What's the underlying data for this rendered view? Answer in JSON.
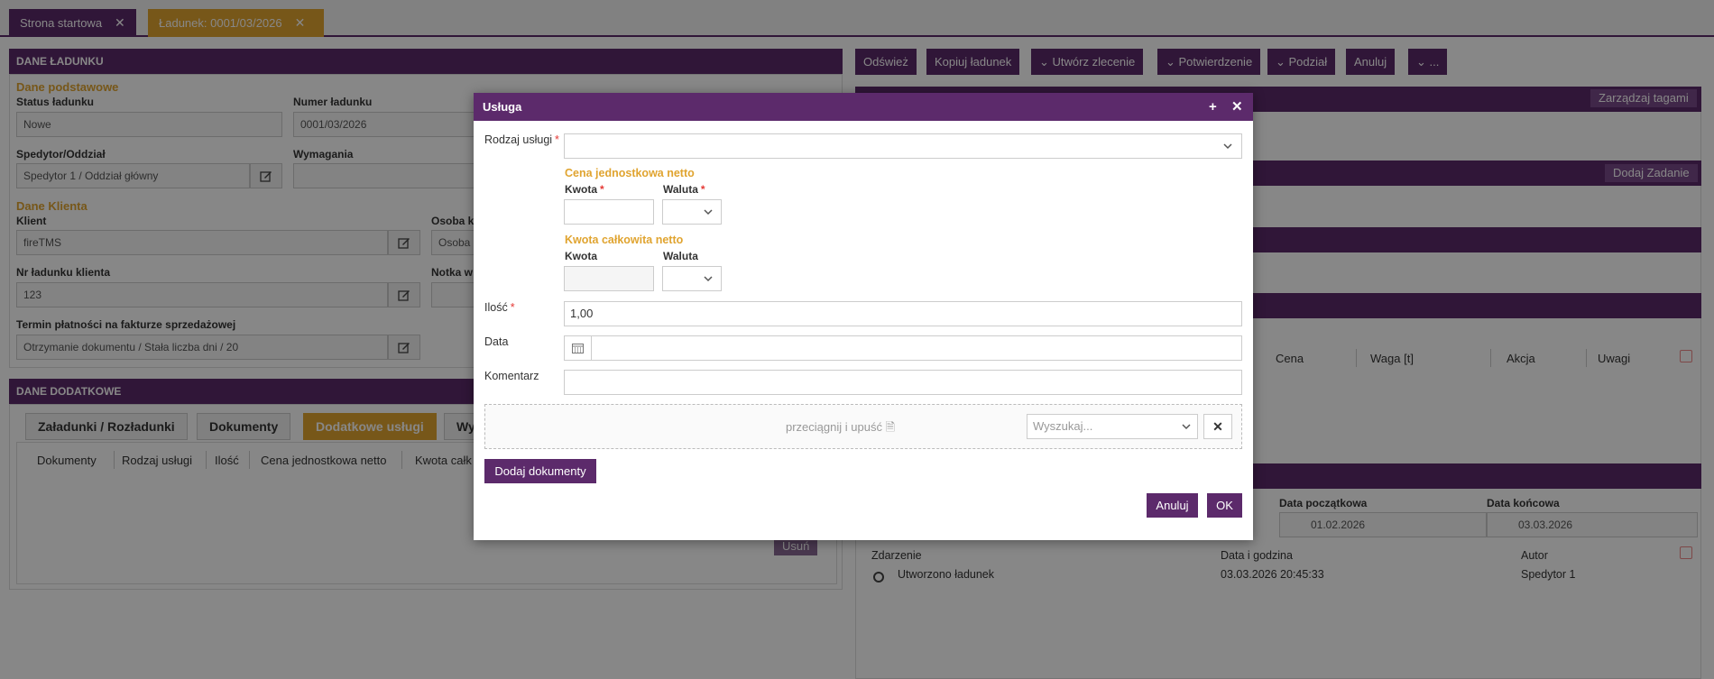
{
  "tabs": [
    {
      "label": "Strona startowa"
    },
    {
      "label": "Ładunek: 0001/03/2026"
    }
  ],
  "cargo_panel": {
    "title": "DANE ŁADUNKU",
    "basic_section": "Dane podstawowe",
    "status_label": "Status ładunku",
    "status_value": "Nowe",
    "number_label": "Numer ładunku",
    "number_value": "0001/03/2026",
    "forwarder_label": "Spedytor/Oddział",
    "forwarder_value": "Spedytor 1 / Oddział główny",
    "requirements_label": "Wymagania",
    "client_section": "Dane Klienta",
    "client_label": "Klient",
    "client_value": "fireTMS",
    "contact_label": "Osoba k",
    "contact_value": "Osoba",
    "client_no_label": "Nr ładunku klienta",
    "client_no_value": "123",
    "note_label": "Notka w",
    "payment_label": "Termin płatności na fakturze sprzedażowej",
    "payment_value": "Otrzymanie dokumentu / Stała liczba dni / 20"
  },
  "extra_panel": {
    "title": "DANE DODATKOWE",
    "tabs": [
      "Załadunki / Rozładunki",
      "Dokumenty",
      "Dodatkowe usługi",
      "Wy"
    ],
    "columns": [
      "Dokumenty",
      "Rodzaj usługi",
      "Ilość",
      "Cena jednostkowa netto",
      "Kwota całk"
    ],
    "remove_btn": "Usuń"
  },
  "toolbar": {
    "refresh": "Odśwież",
    "copy": "Kopiuj ładunek",
    "create_order": "Utwórz zlecenie",
    "confirmation": "Potwierdzenie",
    "split": "Podział",
    "cancel": "Anuluj",
    "more": "..."
  },
  "right_panel": {
    "manage_tags": "Zarządzaj tagami",
    "add_task": "Dodaj Zadanie",
    "goods_columns": [
      "Cena",
      "Waga [t]",
      "Akcja",
      "Uwagi"
    ],
    "start_date_label": "Data początkowa",
    "start_date_value": "01.02.2026",
    "end_date_label": "Data końcowa",
    "end_date_value": "03.03.2026",
    "history_columns": [
      "Zdarzenie",
      "Data i godzina",
      "Autor"
    ],
    "history_row": {
      "event": "Utworzono ładunek",
      "datetime": "03.03.2026 20:45:33",
      "author": "Spedytor 1"
    }
  },
  "modal": {
    "title": "Usługa",
    "service_type_label": "Rodzaj usługi",
    "unit_price_section": "Cena jednostkowa netto",
    "amount_label": "Kwota",
    "currency_label": "Waluta",
    "total_section": "Kwota całkowita netto",
    "quantity_label": "Ilość",
    "quantity_value": "1,00",
    "date_label": "Data",
    "comment_label": "Komentarz",
    "dropzone_text": "przeciągnij i upuść",
    "search_placeholder": "Wyszukaj...",
    "add_documents": "Dodaj dokumenty",
    "cancel": "Anuluj",
    "ok": "OK"
  },
  "colors": {
    "brand": "#5c2a6b",
    "accent": "#e0a430",
    "required": "#e53935"
  }
}
